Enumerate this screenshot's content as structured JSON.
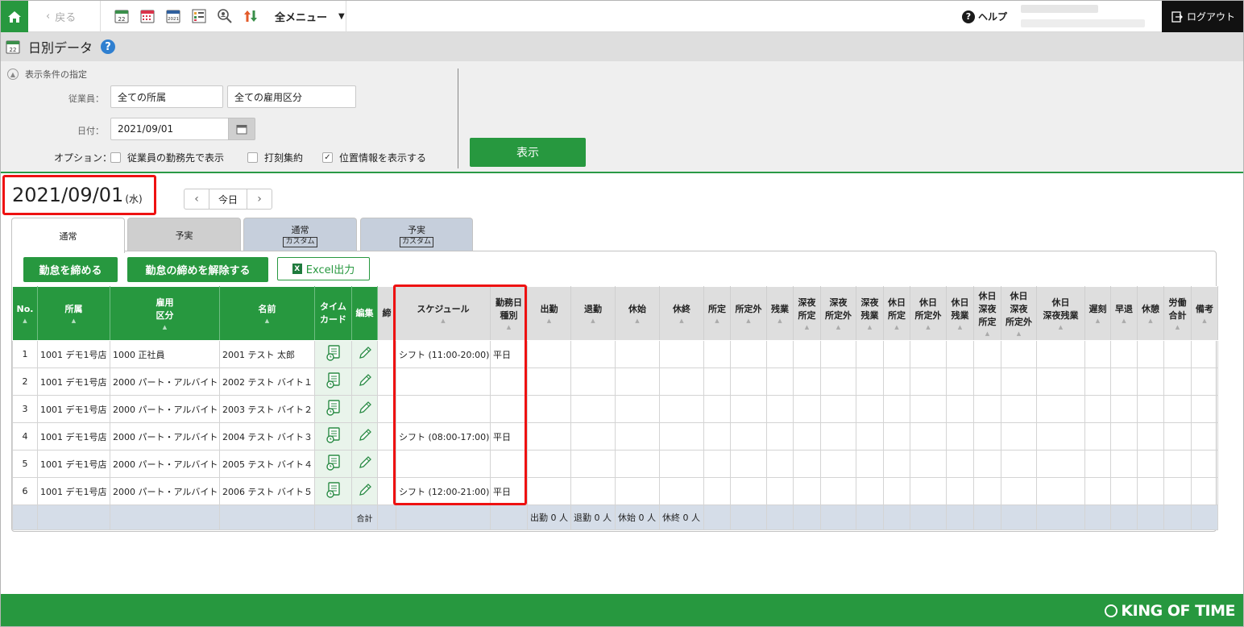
{
  "topbar": {
    "back_label": "戻る",
    "allmenu_label": "全メニュー",
    "help_label": "ヘルプ",
    "logout_label": "ログアウト",
    "tool_icons": [
      "daily-calendar-icon",
      "monthly-calendar-icon",
      "yearly-calendar-icon",
      "schedule-icon",
      "search-person-icon",
      "sort-arrows-icon"
    ],
    "tool_icon_cal_label": "22",
    "tool_icon_year_label": "2021"
  },
  "page": {
    "title": "日別データ",
    "help_mark": "?",
    "title_icon_label": "22"
  },
  "filter": {
    "section_label": "表示条件の指定",
    "employee_label": "従業員：",
    "department_value": "全ての所属",
    "employment_value": "全ての雇用区分",
    "date_label": "日付：",
    "date_value": "2021/09/01",
    "option_label": "オプション：",
    "options": [
      {
        "label": "従業員の勤務先で表示",
        "checked": false
      },
      {
        "label": "打刻集約",
        "checked": false
      },
      {
        "label": "位置情報を表示する",
        "checked": true
      }
    ],
    "show_button": "表示"
  },
  "current_date": {
    "date": "2021/09/01",
    "weekday": "(水)",
    "today_label": "今日"
  },
  "tabs": [
    {
      "label": "通常",
      "sub": ""
    },
    {
      "label": "予実",
      "sub": ""
    },
    {
      "label": "通常",
      "sub": "カスタム"
    },
    {
      "label": "予実",
      "sub": "カスタム"
    }
  ],
  "actions": {
    "close_label": "勤怠を締める",
    "unclose_label": "勤怠の締めを解除する",
    "excel_label": "Excel出力"
  },
  "table": {
    "headers": [
      "No.",
      "所属",
      "雇用\n区分",
      "名前",
      "タイム\nカード",
      "編集",
      "締",
      "スケジュール",
      "勤務日\n種別",
      "出勤",
      "退勤",
      "休始",
      "休終",
      "所定",
      "所定外",
      "残業",
      "深夜\n所定",
      "深夜\n所定外",
      "深夜\n残業",
      "休日\n所定",
      "休日\n所定外",
      "休日\n残業",
      "休日\n深夜\n所定",
      "休日\n深夜\n所定外",
      "休日\n深夜残業",
      "遅刻",
      "早退",
      "休憩",
      "労働\n合計",
      "備考"
    ],
    "rows": [
      {
        "no": "1",
        "dept": "1001 デモ1号店",
        "type": "1000 正社員",
        "name": "2001 テスト 太郎",
        "schedule": "シフト (11:00-20:00)",
        "daytype": "平日"
      },
      {
        "no": "2",
        "dept": "1001 デモ1号店",
        "type": "2000 パート・アルバイト",
        "name": "2002 テスト バイト１",
        "schedule": "",
        "daytype": ""
      },
      {
        "no": "3",
        "dept": "1001 デモ1号店",
        "type": "2000 パート・アルバイト",
        "name": "2003 テスト バイト２",
        "schedule": "",
        "daytype": ""
      },
      {
        "no": "4",
        "dept": "1001 デモ1号店",
        "type": "2000 パート・アルバイト",
        "name": "2004 テスト バイト３",
        "schedule": "シフト (08:00-17:00)",
        "daytype": "平日"
      },
      {
        "no": "5",
        "dept": "1001 デモ1号店",
        "type": "2000 パート・アルバイト",
        "name": "2005 テスト バイト４",
        "schedule": "",
        "daytype": ""
      },
      {
        "no": "6",
        "dept": "1001 デモ1号店",
        "type": "2000 パート・アルバイト",
        "name": "2006 テスト バイト５",
        "schedule": "シフト (12:00-21:00)",
        "daytype": "平日"
      }
    ],
    "totals": {
      "label": "合計",
      "in": "出勤 0 人",
      "out": "退勤 0 人",
      "break_start": "休始 0 人",
      "break_end": "休終 0 人"
    }
  },
  "footer": {
    "logo_text": "KING OF TIME"
  },
  "colors": {
    "brand_green": "#27983f",
    "highlight_red": "#e11111"
  }
}
